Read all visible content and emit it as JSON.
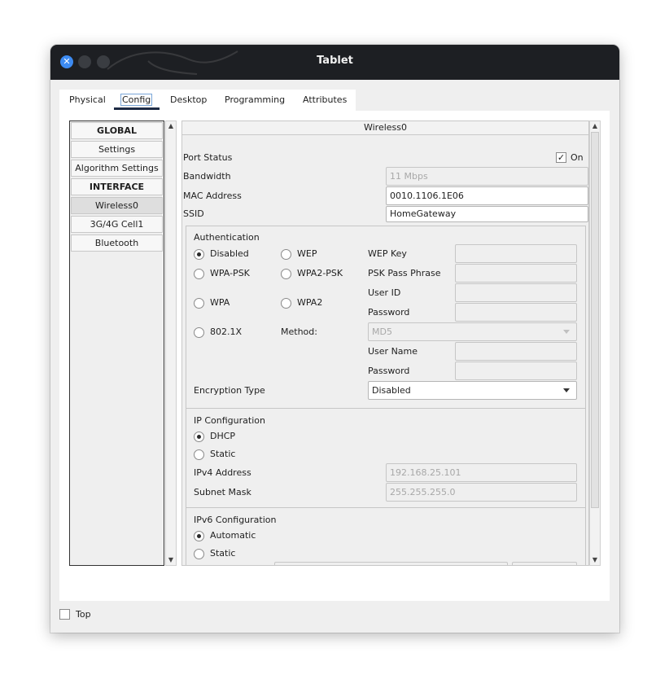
{
  "window": {
    "title": "Tablet"
  },
  "tabs": [
    {
      "label": "Physical"
    },
    {
      "label": "Config"
    },
    {
      "label": "Desktop"
    },
    {
      "label": "Programming"
    },
    {
      "label": "Attributes"
    }
  ],
  "sidebar": {
    "items": [
      {
        "label": "GLOBAL"
      },
      {
        "label": "Settings"
      },
      {
        "label": "Algorithm Settings"
      },
      {
        "label": "INTERFACE"
      },
      {
        "label": "Wireless0"
      },
      {
        "label": "3G/4G Cell1"
      },
      {
        "label": "Bluetooth"
      }
    ]
  },
  "wireless": {
    "header": "Wireless0",
    "port_status_label": "Port Status",
    "port_status_on_label": "On",
    "port_status_on": true,
    "bandwidth_label": "Bandwidth",
    "bandwidth_value": "11 Mbps",
    "mac_label": "MAC Address",
    "mac_value": "0010.1106.1E06",
    "ssid_label": "SSID",
    "ssid_value": "HomeGateway"
  },
  "auth": {
    "title": "Authentication",
    "disabled_label": "Disabled",
    "wep_label": "WEP",
    "wpapsk_label": "WPA-PSK",
    "wpa2psk_label": "WPA2-PSK",
    "wpa_label": "WPA",
    "wpa2_label": "WPA2",
    "dot1x_label": "802.1X",
    "method_label": "Method:",
    "method_value": "MD5",
    "wep_key_label": "WEP Key",
    "psk_label": "PSK Pass Phrase",
    "user_id_label": "User ID",
    "password_label": "Password",
    "user_name_label": "User Name",
    "password2_label": "Password",
    "encryption_label": "Encryption Type",
    "encryption_value": "Disabled",
    "selected": "Disabled"
  },
  "ip": {
    "title": "IP Configuration",
    "dhcp_label": "DHCP",
    "static_label": "Static",
    "selected": "DHCP",
    "ipv4_label": "IPv4 Address",
    "ipv4_value": "192.168.25.101",
    "mask_label": "Subnet Mask",
    "mask_value": "255.255.255.0"
  },
  "ipv6": {
    "title": "IPv6 Configuration",
    "auto_label": "Automatic",
    "static_label": "Static",
    "selected": "Automatic"
  },
  "footer": {
    "top_label": "Top"
  }
}
